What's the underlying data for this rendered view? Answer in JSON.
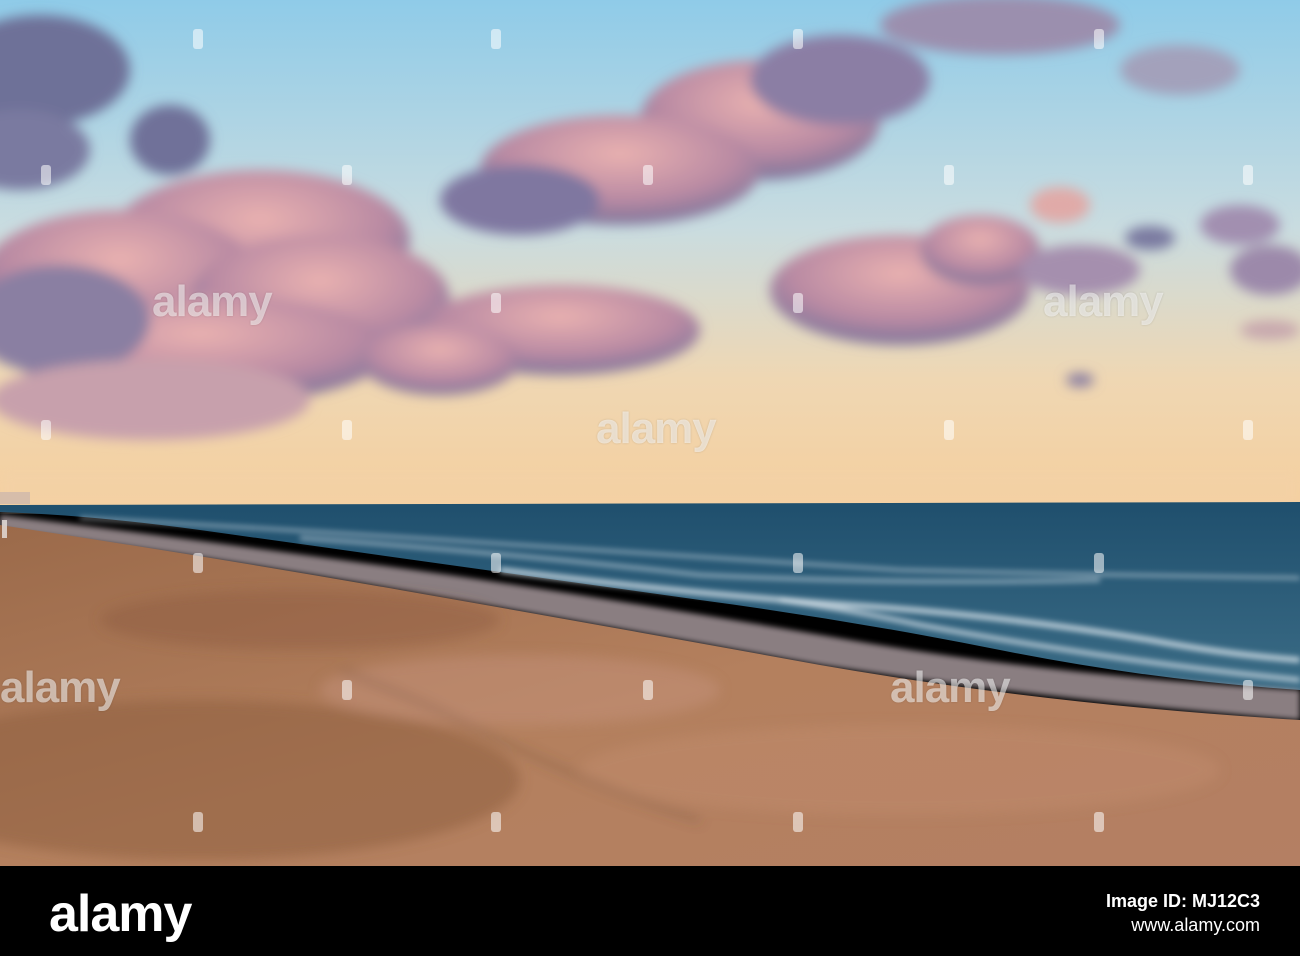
{
  "watermark": {
    "text": "alamy"
  },
  "footer": {
    "logo": "alamy",
    "image_id": "Image ID: MJ12C3",
    "url": "www.alamy.com"
  },
  "colors": {
    "sky_top": "#9cd3ea",
    "sky_bottom": "#f6cf9e",
    "cloud": "#b98aa3",
    "sea": "#2f5f78",
    "sand": "#a36f4e",
    "footer_bg": "#000000"
  }
}
